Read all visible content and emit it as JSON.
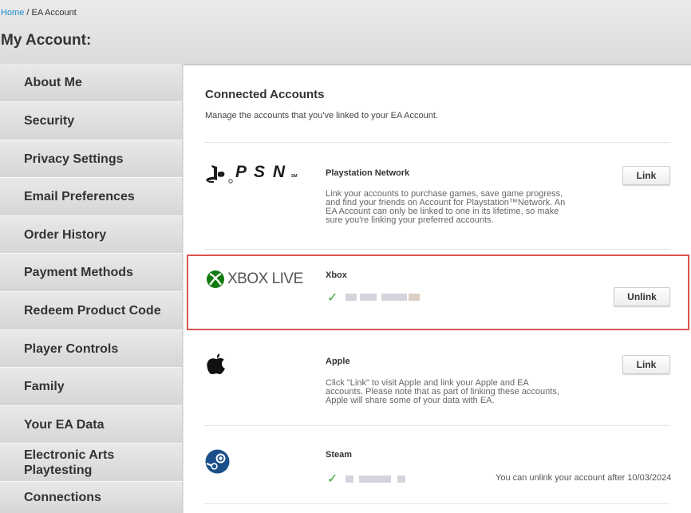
{
  "breadcrumb": {
    "home": "Home",
    "sep": "/",
    "current": "EA Account"
  },
  "page_title": "My Account:",
  "sidebar": {
    "items": [
      {
        "label": "About Me"
      },
      {
        "label": "Security"
      },
      {
        "label": "Privacy Settings"
      },
      {
        "label": "Email Preferences"
      },
      {
        "label": "Order History"
      },
      {
        "label": "Payment Methods"
      },
      {
        "label": "Redeem Product Code"
      },
      {
        "label": "Player Controls"
      },
      {
        "label": "Family"
      },
      {
        "label": "Your EA Data"
      },
      {
        "label": "Electronic Arts Playtesting"
      },
      {
        "label": "Connections"
      }
    ]
  },
  "content": {
    "title": "Connected Accounts",
    "description": "Manage the accounts that you've linked to your EA Account."
  },
  "accounts": {
    "psn": {
      "logo": "P S N",
      "logo_sm": "SM",
      "name": "Playstation Network",
      "description": "Link your accounts to purchase games, save game progress, and find your friends on Account for Playstation™Network. An EA Account can only be linked to one in its lifetime, so make sure you're linking your preferred accounts.",
      "button": "Link"
    },
    "xbox": {
      "logo": "XBOX LIVE",
      "name": "Xbox",
      "button": "Unlink"
    },
    "apple": {
      "name": "Apple",
      "description": "Click \"Link\" to visit Apple and link your Apple and EA accounts. Please note that as part of linking these accounts, Apple will share some of your data with EA.",
      "button": "Link"
    },
    "steam": {
      "name": "Steam",
      "note": "You can unlink your account after 10/03/2024"
    }
  },
  "colors": {
    "link": "#1a8ccf",
    "check": "#3aa33a",
    "highlight": "#d9534f",
    "xbox_green": "#107c10",
    "steam_blue": "#1b4f8a"
  }
}
